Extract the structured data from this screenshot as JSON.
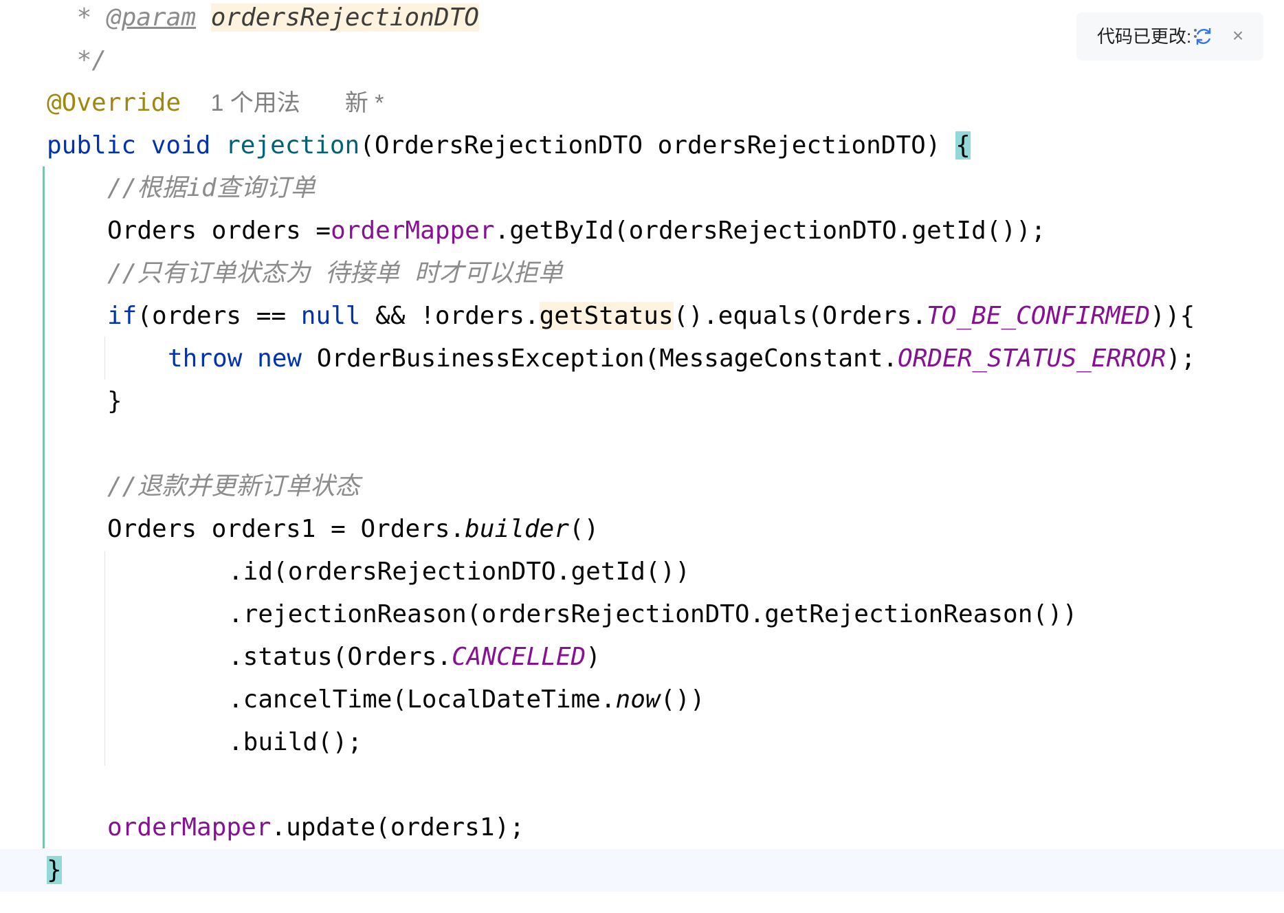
{
  "editor": {
    "lines": {
      "l1": {
        "star": " * ",
        "tag": "@param",
        "sp": " ",
        "param": "ordersRejectionDTO"
      },
      "l2": {
        "text": " */"
      },
      "l3": {
        "annotation": "@Override",
        "usages": "1 个用法",
        "author": "新 *"
      },
      "l4": {
        "public": "public",
        "void": "void",
        "method": "rejection",
        "args": "(OrdersRejectionDTO ordersRejectionDTO) ",
        "brace": "{"
      },
      "l5": {
        "comment": "//根据id查询订单"
      },
      "l6": {
        "a": "Orders orders =",
        "mapper": "orderMapper",
        "b": ".getById(ordersRejectionDTO.getId());"
      },
      "l7": {
        "comment": "//只有订单状态为 待接单 时才可以拒单"
      },
      "l8": {
        "if": "if",
        "a": "(orders == ",
        "null": "null",
        "b": " && !orders.",
        "getStatus": "getStatus",
        "c": "().equals(Orders.",
        "const": "TO_BE_CONFIRMED",
        "d": ")){"
      },
      "l9": {
        "throw": "throw",
        "new": "new",
        "a": " OrderBusinessException(MessageConstant.",
        "const": "ORDER_STATUS_ERROR",
        "b": ");"
      },
      "l10": {
        "text": "}"
      },
      "l12": {
        "comment": "//退款并更新订单状态"
      },
      "l13": {
        "a": "Orders orders1 = Orders.",
        "builder": "builder",
        "b": "()"
      },
      "l14": {
        "text": ".id(ordersRejectionDTO.getId())"
      },
      "l15": {
        "text": ".rejectionReason(ordersRejectionDTO.getRejectionReason())"
      },
      "l16": {
        "a": ".status(Orders.",
        "const": "CANCELLED",
        "b": ")"
      },
      "l17": {
        "a": ".cancelTime(LocalDateTime.",
        "now": "now",
        "b": "())"
      },
      "l18": {
        "text": ".build();"
      },
      "l20": {
        "mapper": "orderMapper",
        "b": ".update(orders1);"
      },
      "l21": {
        "brace": "}"
      }
    }
  },
  "notification": {
    "text": "代码已更改:",
    "reload_icon": "reload-changes-icon",
    "close_icon": "close-icon",
    "close_glyph": "×"
  },
  "colors": {
    "keyword": "#0033b3",
    "method": "#00627a",
    "field": "#871094",
    "comment": "#8c8c8c",
    "annotation": "#9e880d",
    "change_marker": "#7fc3ad",
    "brace_match": "#93d9d9",
    "usage_highlight": "#fdf3de"
  }
}
